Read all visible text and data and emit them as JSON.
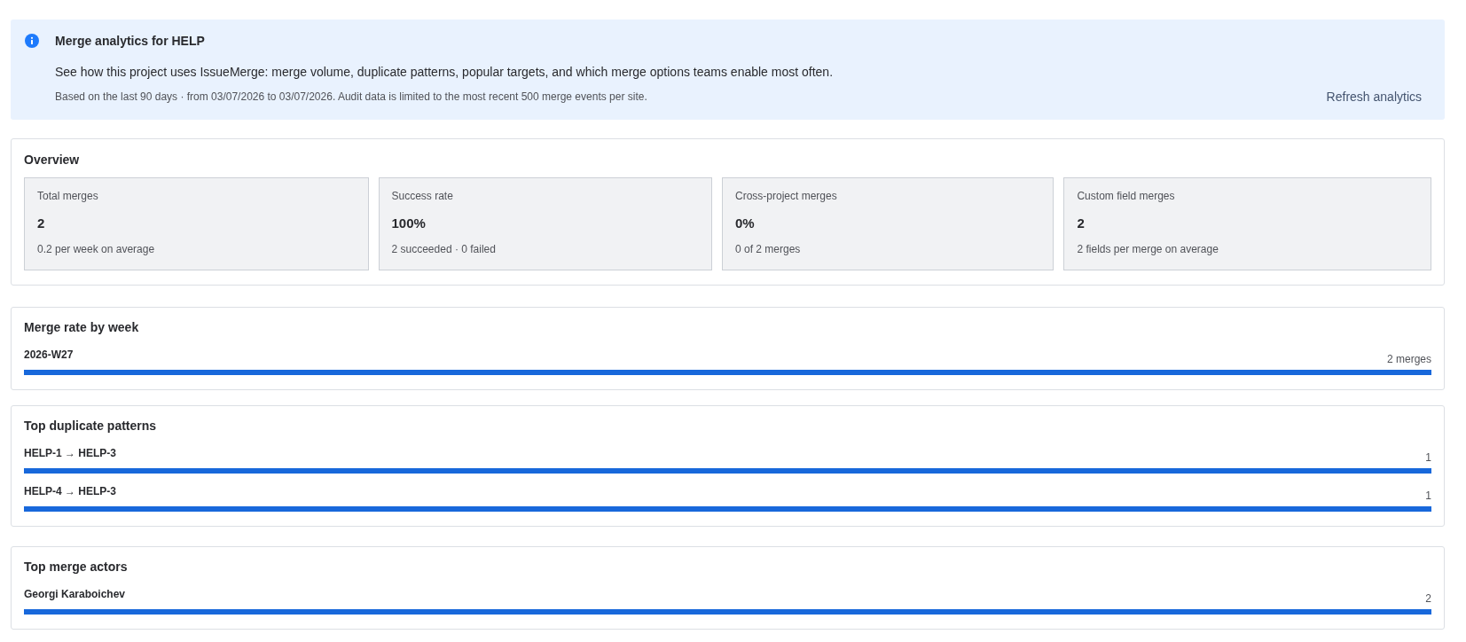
{
  "banner": {
    "title": "Merge analytics for HELP",
    "description": "See how this project uses IssueMerge: merge volume, duplicate patterns, popular targets, and which merge options teams enable most often.",
    "note": "Based on the last 90 days · from 03/07/2026 to 03/07/2026. Audit data is limited to the most recent 500 merge events per site.",
    "button": "Refresh analytics"
  },
  "overview": {
    "title": "Overview",
    "stats": [
      {
        "label": "Total merges",
        "value": "2",
        "detail": "0.2 per week on average"
      },
      {
        "label": "Success rate",
        "value": "100%",
        "detail": "2 succeeded · 0 failed"
      },
      {
        "label": "Cross-project merges",
        "value": "0%",
        "detail": "0 of 2 merges"
      },
      {
        "label": "Custom field merges",
        "value": "2",
        "detail": "2 fields per merge on average"
      }
    ]
  },
  "sections": [
    {
      "title": "Merge rate by week",
      "rows": [
        {
          "label": "2026-W27",
          "value": "2 merges",
          "level": 1
        }
      ]
    },
    {
      "title": "Top duplicate patterns",
      "rows": [
        {
          "label": "HELP-1 → HELP-3",
          "value": "1",
          "level": 1
        },
        {
          "label": "HELP-4 → HELP-3",
          "value": "1",
          "level": 1
        }
      ]
    },
    {
      "title": "Top merge actors",
      "rows": [
        {
          "label": "Georgi Karaboichev",
          "value": "2",
          "level": 1
        }
      ]
    }
  ]
}
